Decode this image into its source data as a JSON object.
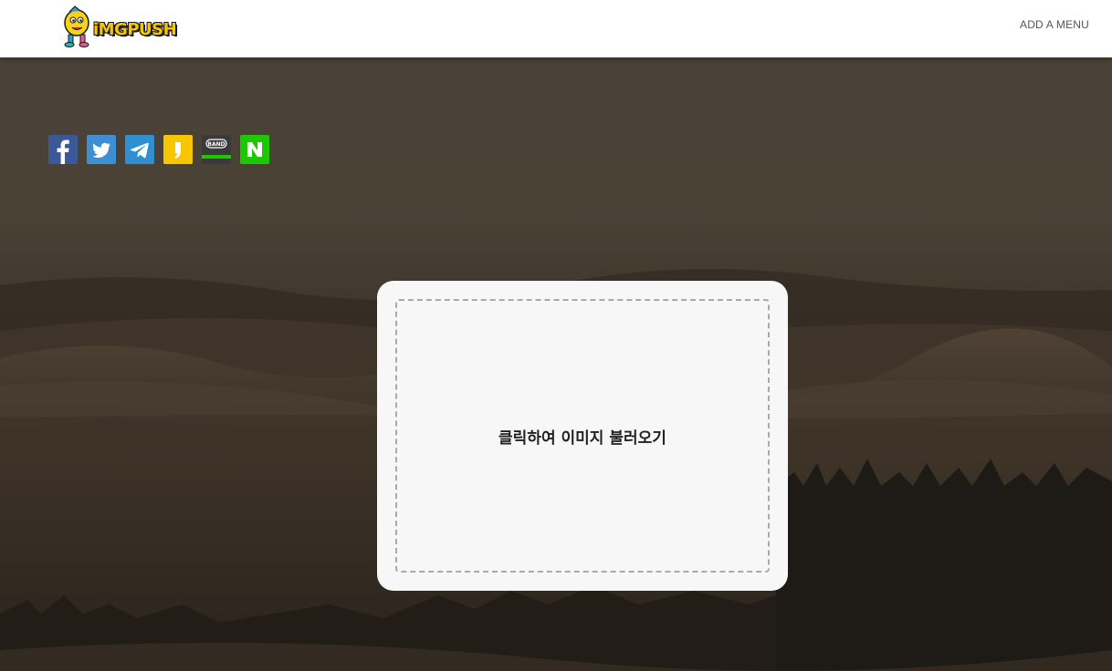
{
  "header": {
    "logo_text": "iMGPUSH",
    "menu_label": "ADD A MENU"
  },
  "share": {
    "buttons": [
      {
        "name": "facebook",
        "icon": "facebook-icon",
        "color": "#3b5998"
      },
      {
        "name": "twitter",
        "icon": "twitter-icon",
        "color": "#3d8fd1"
      },
      {
        "name": "telegram",
        "icon": "telegram-icon",
        "color": "#2f8fd0"
      },
      {
        "name": "kakaostory",
        "icon": "kakaostory-icon",
        "color": "#f7c600"
      },
      {
        "name": "band",
        "icon": "band-icon",
        "color": "#3a3a3a",
        "label": "BAND"
      },
      {
        "name": "naver",
        "icon": "naver-icon",
        "color": "#1ec800"
      }
    ]
  },
  "upload": {
    "label": "클릭하여 이미지 불러오기"
  }
}
